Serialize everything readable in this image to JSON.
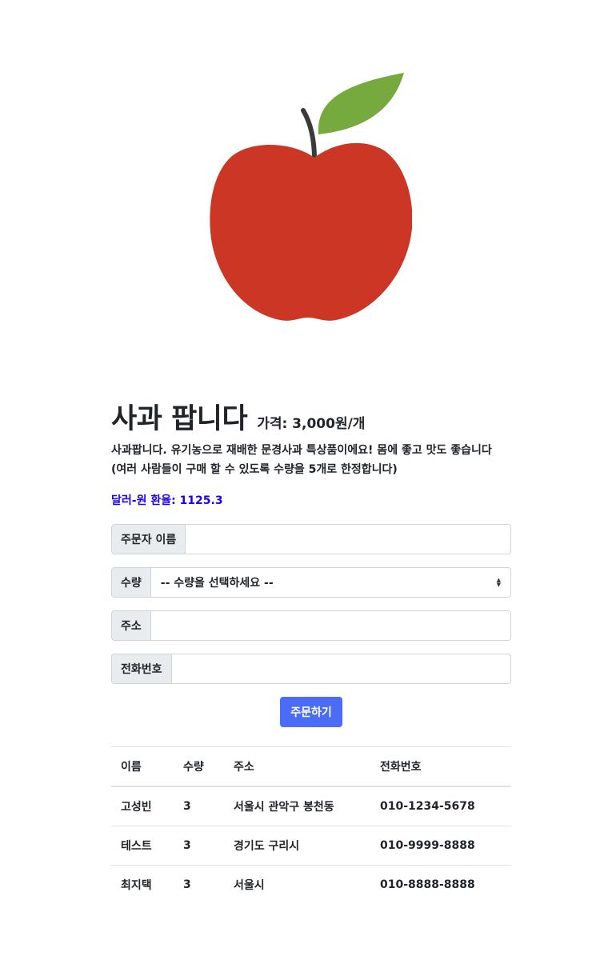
{
  "product": {
    "title": "사과 팝니다",
    "price": "가격: 3,000원/개",
    "description_line1": "사과팝니다. 유기농으로 재배한 문경사과 특상품이에요! 몸에 좋고 맛도 좋습니다",
    "description_line2": "(여러 사람들이 구매 할 수 있도록 수량을 5개로 한정합니다)",
    "exchange_label": "달러-원 환율: 1125.3",
    "image_icon": "apple-illustration",
    "colors": {
      "apple": "#cc3625",
      "leaf": "#76a93e",
      "stem": "#3a3a3a",
      "rate_text": "#1a00ff",
      "button": "#4a6cf7"
    }
  },
  "form": {
    "name_label": "주문자 이름",
    "name_value": "",
    "qty_label": "수량",
    "qty_selected": "-- 수량을 선택하세요 --",
    "address_label": "주소",
    "address_value": "",
    "phone_label": "전화번호",
    "phone_value": "",
    "submit_label": "주문하기"
  },
  "orders": {
    "headers": [
      "이름",
      "수량",
      "주소",
      "전화번호"
    ],
    "rows": [
      [
        "고성빈",
        "3",
        "서울시 관악구 봉천동",
        "010-1234-5678"
      ],
      [
        "테스트",
        "3",
        "경기도 구리시",
        "010-9999-8888"
      ],
      [
        "최지택",
        "3",
        "서울시",
        "010-8888-8888"
      ]
    ]
  }
}
